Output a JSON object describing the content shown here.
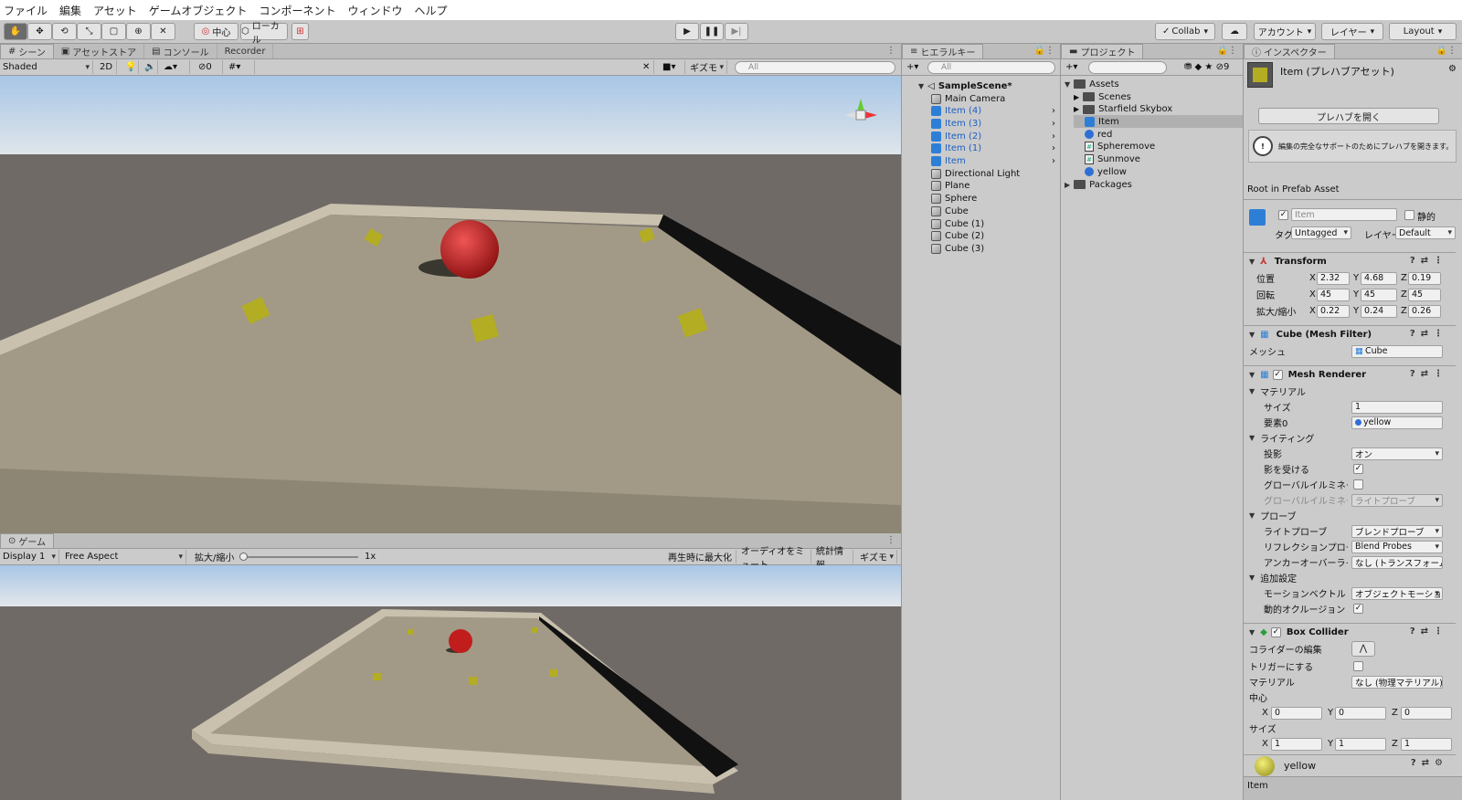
{
  "menu": [
    "ファイル",
    "編集",
    "アセット",
    "ゲームオブジェクト",
    "コンポーネント",
    "ウィンドウ",
    "ヘルプ"
  ],
  "toolbar": {
    "pivot": "中心",
    "space": "ローカル",
    "collab": "Collab",
    "account": "アカウント",
    "layers": "レイヤー",
    "layout": "Layout"
  },
  "scene": {
    "tabs": [
      "シーン",
      "アセットストア",
      "コンソール",
      "Recorder"
    ],
    "shading": "Shaded",
    "mode2d": "2D",
    "hidden_count": "0",
    "gizmos": "ギズモ",
    "search": "All"
  },
  "game": {
    "tab": "ゲーム",
    "display": "Display 1",
    "aspect": "Free Aspect",
    "scale_label": "拡大/縮小",
    "scale_value": "1x",
    "buttons": [
      "再生時に最大化",
      "オーディオをミュート",
      "統計情報",
      "ギズモ"
    ]
  },
  "hierarchy": {
    "tab": "ヒエラルキー",
    "search": "All",
    "scene": "SampleScene*",
    "items": [
      {
        "label": "Main Camera",
        "type": "obj"
      },
      {
        "label": "Item (4)",
        "type": "prefab"
      },
      {
        "label": "Item (3)",
        "type": "prefab"
      },
      {
        "label": "Item (2)",
        "type": "prefab"
      },
      {
        "label": "Item (1)",
        "type": "prefab"
      },
      {
        "label": "Item",
        "type": "prefab"
      },
      {
        "label": "Directional Light",
        "type": "obj"
      },
      {
        "label": "Plane",
        "type": "obj"
      },
      {
        "label": "Sphere",
        "type": "obj"
      },
      {
        "label": "Cube",
        "type": "obj"
      },
      {
        "label": "Cube (1)",
        "type": "obj"
      },
      {
        "label": "Cube (2)",
        "type": "obj"
      },
      {
        "label": "Cube (3)",
        "type": "obj"
      }
    ]
  },
  "project": {
    "tab": "プロジェクト",
    "hidden": "9",
    "root": "Assets",
    "items": [
      {
        "label": "Scenes",
        "type": "folder"
      },
      {
        "label": "Starfield Skybox",
        "type": "folder"
      },
      {
        "label": "Item",
        "type": "prefab"
      },
      {
        "label": "red",
        "type": "mat"
      },
      {
        "label": "Spheremove",
        "type": "script"
      },
      {
        "label": "Sunmove",
        "type": "script"
      },
      {
        "label": "yellow",
        "type": "mat"
      }
    ],
    "packages": "Packages"
  },
  "inspector": {
    "tab": "インスペクター",
    "title": "Item (プレハブアセット)",
    "open_prefab": "プレハブを開く",
    "warning": "編集の完全なサポートのためにプレハブを開きます。",
    "root_label": "Root in Prefab Asset",
    "name": "Item",
    "static": "静的",
    "tag_label": "タグ",
    "tag": "Untagged",
    "layer_label": "レイヤー",
    "layer": "Default",
    "transform": {
      "title": "Transform",
      "pos_label": "位置",
      "pos": [
        "2.32",
        "4.68",
        "0.19"
      ],
      "rot_label": "回転",
      "rot": [
        "45",
        "45",
        "45"
      ],
      "scale_label": "拡大/縮小",
      "scale": [
        "0.22",
        "0.24",
        "0.26"
      ]
    },
    "mesh_filter": {
      "title": "Cube (Mesh Filter)",
      "mesh_label": "メッシュ",
      "mesh": "Cube"
    },
    "mesh_renderer": {
      "title": "Mesh Renderer",
      "materials": "マテリアル",
      "size_label": "サイズ",
      "size": "1",
      "elem_label": "要素0",
      "elem": "yellow",
      "lighting": "ライティング",
      "cast_label": "投影",
      "cast": "オン",
      "receive_label": "影を受ける",
      "gi_label": "グローバルイルミネーション",
      "gi2_label": "グローバルイルミネーション",
      "gi2": "ライトプローブ",
      "probes": "プローブ",
      "lp_label": "ライトプローブ",
      "lp": "ブレンドプローブ",
      "rp_label": "リフレクションプローブ",
      "rp": "Blend Probes",
      "anchor_label": "アンカーオーバーライド",
      "anchor": "なし (トランスフォーム)",
      "extra": "追加設定",
      "motion_label": "モーションベクトル",
      "motion": "オブジェクトモーション",
      "occl_label": "動的オクルージョン"
    },
    "box_collider": {
      "title": "Box Collider",
      "edit_label": "コライダーの編集",
      "trigger_label": "トリガーにする",
      "mat_label": "マテリアル",
      "mat": "なし (物理マテリアル)",
      "center_label": "中心",
      "center": [
        "0",
        "0",
        "0"
      ],
      "size_label": "サイズ",
      "size": [
        "1",
        "1",
        "1"
      ]
    },
    "material": {
      "title": "yellow"
    },
    "footer": "Item"
  },
  "colors": {
    "sky_top": "#a8c6e6",
    "ground": "#6f6a66",
    "floor": "#a29a86",
    "ball": "#c21d1d",
    "cube": "#b3ad24",
    "accent": "#2d7fd6"
  }
}
